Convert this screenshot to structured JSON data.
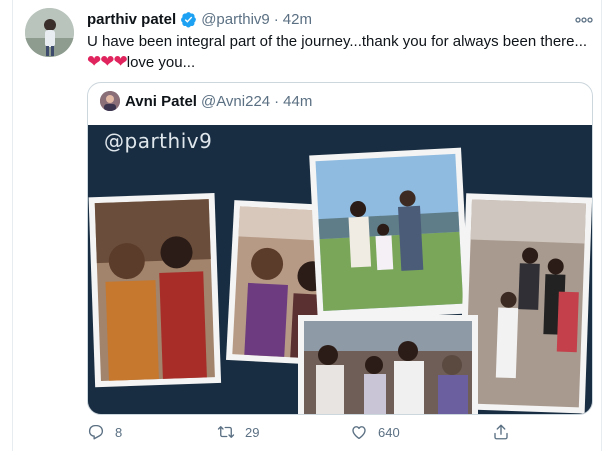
{
  "tweet": {
    "author_name": "parthiv patel",
    "author_handle": "@parthiv9",
    "separator": "·",
    "time": "42m",
    "text_line1": "U have been integral part of the journey...thank you for always been there...",
    "text_line2_hearts": "❤❤❤",
    "text_line2_rest": "love you...",
    "icons": {
      "verified": "verified-badge-icon",
      "more": "more-options-icon"
    },
    "colors": {
      "verified": "#1da1f2",
      "heart": "#e0245e",
      "secondary_text": "#5b7083"
    }
  },
  "quoted_tweet": {
    "author_name": "Avni Patel",
    "author_handle": "@Avni224",
    "separator": "·",
    "time": "44m",
    "image_overlay_text": "@parthiv9"
  },
  "actions": {
    "reply_count": "8",
    "retweet_count": "29",
    "like_count": "640",
    "icons": [
      "reply-icon",
      "retweet-icon",
      "like-icon",
      "share-icon"
    ]
  }
}
